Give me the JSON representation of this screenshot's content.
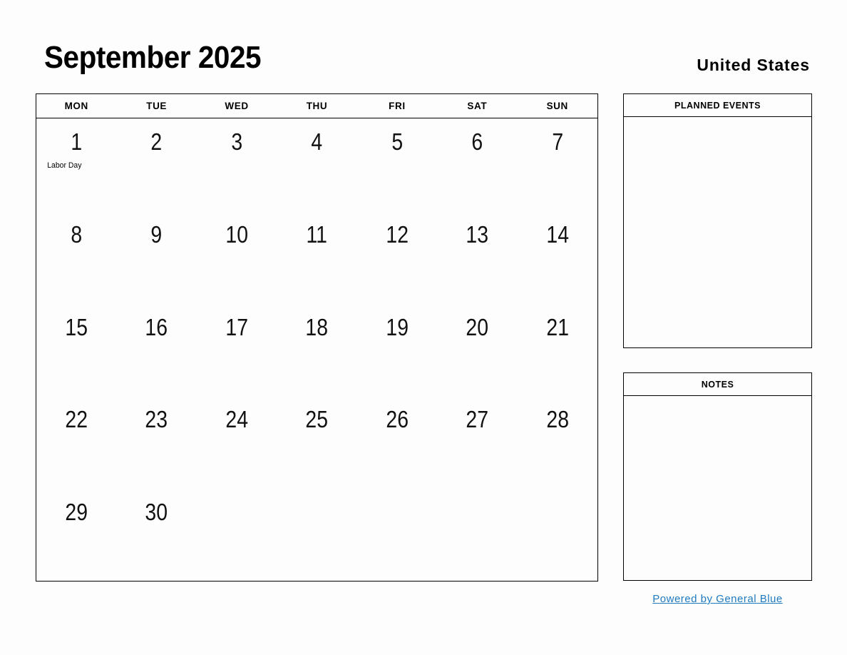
{
  "header": {
    "month_title": "September 2025",
    "country": "United States"
  },
  "calendar": {
    "weekdays": [
      "MON",
      "TUE",
      "WED",
      "THU",
      "FRI",
      "SAT",
      "SUN"
    ],
    "weeks": [
      [
        {
          "day": "1",
          "event": "Labor Day"
        },
        {
          "day": "2",
          "event": ""
        },
        {
          "day": "3",
          "event": ""
        },
        {
          "day": "4",
          "event": ""
        },
        {
          "day": "5",
          "event": ""
        },
        {
          "day": "6",
          "event": ""
        },
        {
          "day": "7",
          "event": ""
        }
      ],
      [
        {
          "day": "8",
          "event": ""
        },
        {
          "day": "9",
          "event": ""
        },
        {
          "day": "10",
          "event": ""
        },
        {
          "day": "11",
          "event": ""
        },
        {
          "day": "12",
          "event": ""
        },
        {
          "day": "13",
          "event": ""
        },
        {
          "day": "14",
          "event": ""
        }
      ],
      [
        {
          "day": "15",
          "event": ""
        },
        {
          "day": "16",
          "event": ""
        },
        {
          "day": "17",
          "event": ""
        },
        {
          "day": "18",
          "event": ""
        },
        {
          "day": "19",
          "event": ""
        },
        {
          "day": "20",
          "event": ""
        },
        {
          "day": "21",
          "event": ""
        }
      ],
      [
        {
          "day": "22",
          "event": ""
        },
        {
          "day": "23",
          "event": ""
        },
        {
          "day": "24",
          "event": ""
        },
        {
          "day": "25",
          "event": ""
        },
        {
          "day": "26",
          "event": ""
        },
        {
          "day": "27",
          "event": ""
        },
        {
          "day": "28",
          "event": ""
        }
      ],
      [
        {
          "day": "29",
          "event": ""
        },
        {
          "day": "30",
          "event": ""
        },
        {
          "day": "",
          "event": ""
        },
        {
          "day": "",
          "event": ""
        },
        {
          "day": "",
          "event": ""
        },
        {
          "day": "",
          "event": ""
        },
        {
          "day": "",
          "event": ""
        }
      ]
    ]
  },
  "panels": {
    "planned_events": {
      "title": "PLANNED EVENTS",
      "content": ""
    },
    "notes": {
      "title": "NOTES",
      "content": ""
    }
  },
  "footer": {
    "link_text": "Powered by General Blue",
    "link_color": "#1f7ac0"
  }
}
